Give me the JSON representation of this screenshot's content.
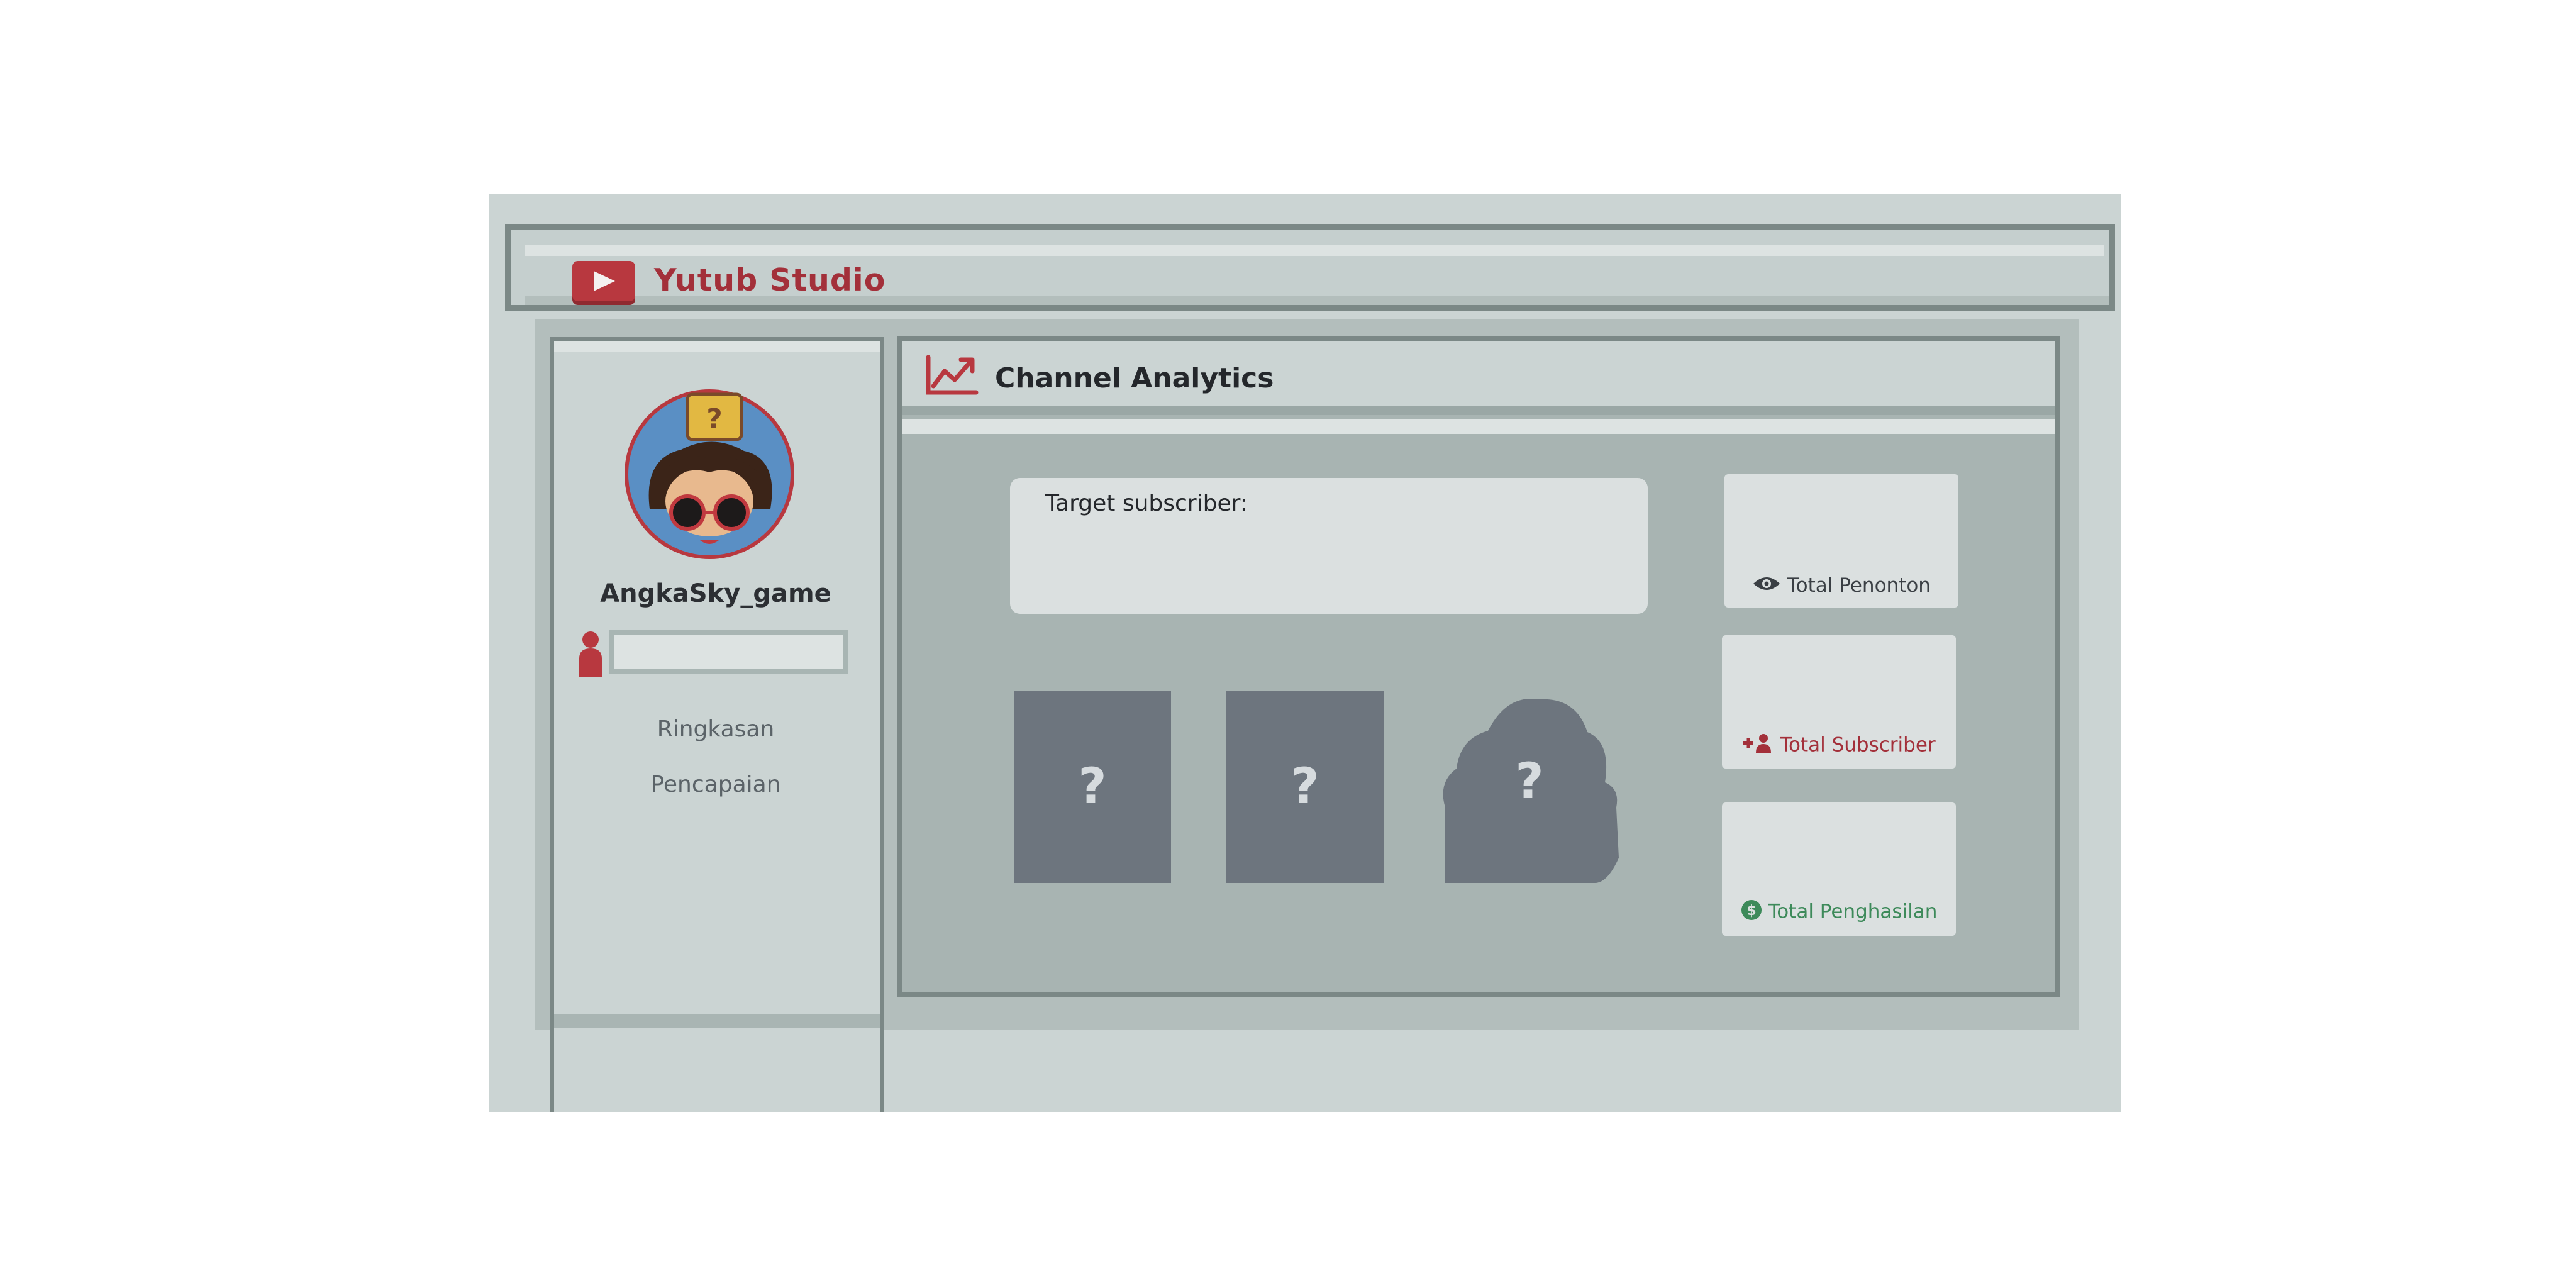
{
  "app": {
    "title": "Yutub Studio",
    "brand_color": "#a3303a"
  },
  "sidebar": {
    "channel_name": "AngkaSky_game",
    "subscriber_field_value": "",
    "nav": [
      {
        "label": "Ringkasan"
      },
      {
        "label": "Pencapaian"
      }
    ]
  },
  "main": {
    "title": "Channel Analytics",
    "target_label": "Target subscriber:",
    "stats": [
      {
        "label": "Total Penonton",
        "icon": "eye-icon",
        "color": "#3a3f44"
      },
      {
        "label": "Total Subscriber",
        "icon": "add-person-icon",
        "color": "#a3303a"
      },
      {
        "label": "Total Penghasilan",
        "icon": "dollar-coin-icon",
        "color": "#3d8a5a"
      }
    ],
    "locked_items": [
      {
        "label": "?"
      },
      {
        "label": "?"
      },
      {
        "label": "?"
      }
    ]
  }
}
